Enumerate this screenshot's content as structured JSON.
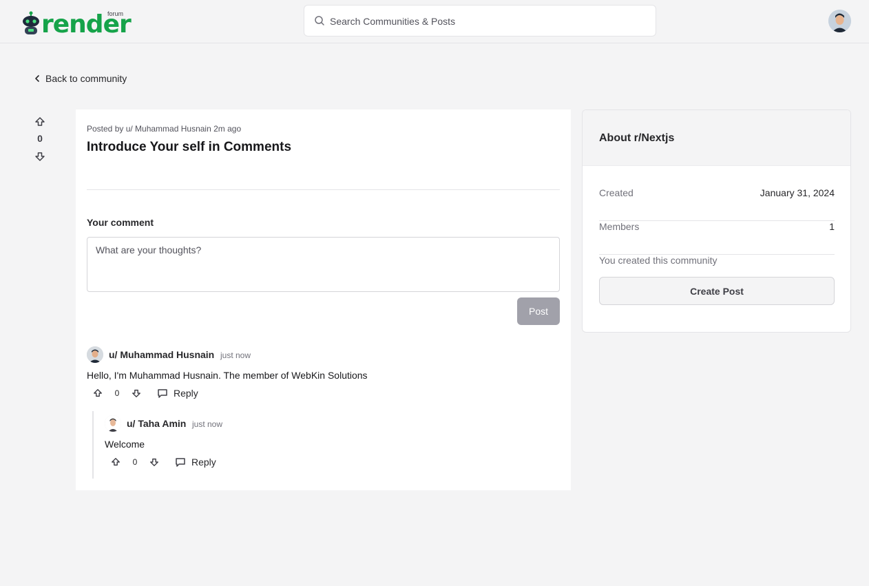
{
  "header": {
    "logo_word": "render",
    "logo_sub": "forum",
    "search_placeholder": "Search Communities & Posts",
    "brand_color": "#16a34a"
  },
  "nav": {
    "back_label": "Back to community"
  },
  "post": {
    "votes": "0",
    "meta": "Posted by u/ Muhammad Husnain 2m ago",
    "title": "Introduce Your self in Comments",
    "comment_label": "Your comment",
    "comment_placeholder": "What are your thoughts?",
    "post_button": "Post"
  },
  "comments": [
    {
      "user": "u/ Muhammad Husnain",
      "time": "just now",
      "body": "Hello, I'm Muhammad Husnain. The member of WebKin Solutions",
      "votes": "0",
      "reply_label": "Reply"
    },
    {
      "user": "u/ Taha Amin",
      "time": "just now",
      "body": "Welcome",
      "votes": "0",
      "reply_label": "Reply"
    }
  ],
  "sidebar": {
    "title": "About r/Nextjs",
    "rows": [
      {
        "key": "Created",
        "value": "January 31, 2024"
      },
      {
        "key": "Members",
        "value": "1"
      }
    ],
    "note": "You created this community",
    "create_button": "Create Post"
  },
  "icons": [
    "search-icon",
    "user-avatar-icon",
    "chevron-left-icon",
    "upvote-icon",
    "downvote-icon",
    "reply-icon"
  ]
}
